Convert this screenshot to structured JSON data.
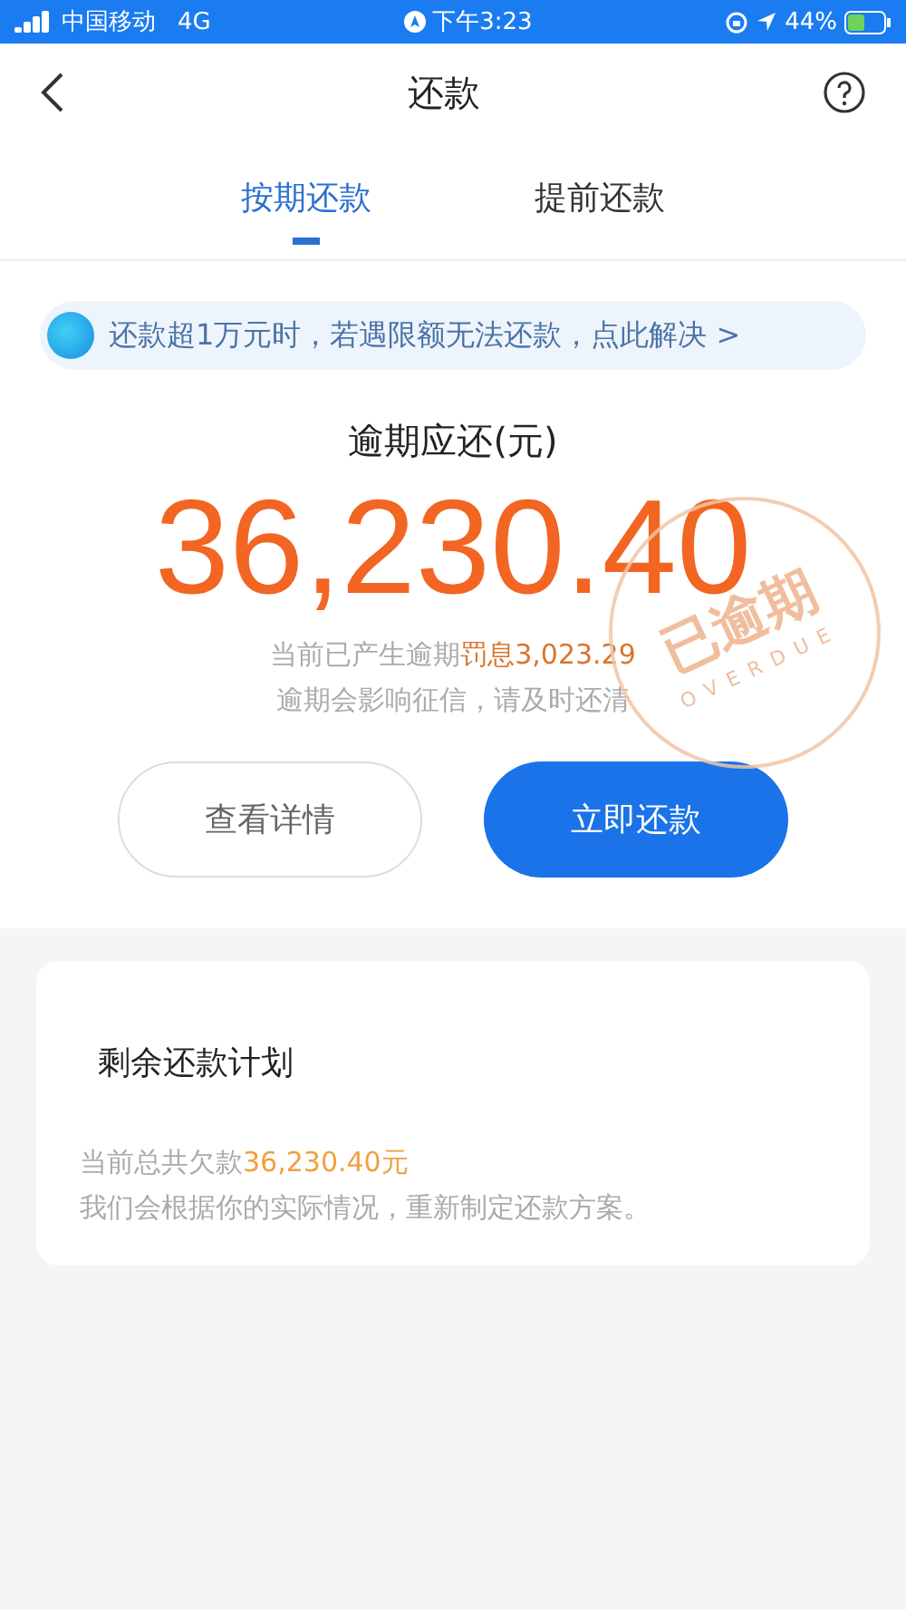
{
  "status_bar": {
    "carrier": "中国移动",
    "network": "4G",
    "time": "下午3:23",
    "battery": "44%"
  },
  "nav": {
    "title": "还款"
  },
  "tabs": [
    {
      "label": "按期还款",
      "selected": true
    },
    {
      "label": "提前还款",
      "selected": false
    }
  ],
  "notice": {
    "text": "还款超1万元时，若遇限额无法还款，点此解决 >"
  },
  "overdue": {
    "label": "逾期应还(元)",
    "amount": "36,230.40",
    "stamp": "已逾期",
    "stamp_sub": "OVERDUE",
    "penalty": {
      "text": "当前已产生逾期",
      "highlight": "罚息3,023.29"
    },
    "warning": "逾期会影响征信，请及时还清"
  },
  "buttons": [
    {
      "label": "查看详情",
      "kind": "outline"
    },
    {
      "label": "立即还款",
      "kind": "primary"
    }
  ],
  "plan": {
    "title": "剩余还款计划",
    "total": {
      "text": "当前总共欠款",
      "highlight": "36,230.40元"
    },
    "note": "我们会根据你的实际情况，重新制定还款方案。"
  }
}
